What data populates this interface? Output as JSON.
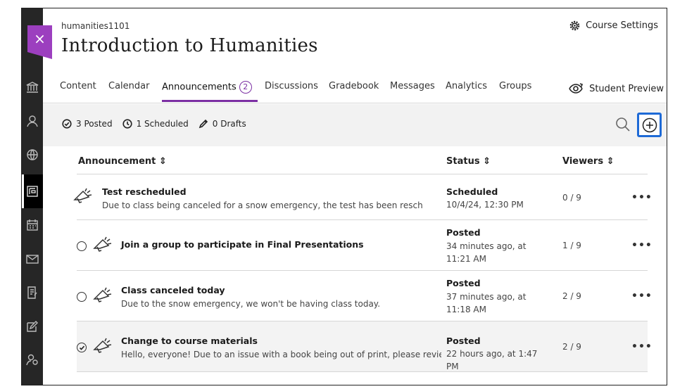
{
  "header": {
    "close_glyph": "×",
    "course_id": "humanities1101",
    "course_title": "Introduction to Humanities",
    "settings_label": "Course Settings"
  },
  "rail_icons": [
    "institution-icon",
    "profile-icon",
    "globe-icon",
    "courses-icon",
    "calendar-icon",
    "messages-icon",
    "grades-icon",
    "tools-icon",
    "groups-icon"
  ],
  "tabs": [
    {
      "label": "Content"
    },
    {
      "label": "Calendar"
    },
    {
      "label": "Announcements",
      "badge": "2"
    },
    {
      "label": "Discussions"
    },
    {
      "label": "Gradebook"
    },
    {
      "label": "Messages"
    },
    {
      "label": "Analytics"
    },
    {
      "label": "Groups"
    }
  ],
  "preview_label": "Student Preview",
  "summary": {
    "posted": "3 Posted",
    "scheduled": "1 Scheduled",
    "drafts": "0 Drafts"
  },
  "table": {
    "headers": {
      "announcement": "Announcement ⇕",
      "status": "Status ⇕",
      "viewers": "Viewers ⇕"
    },
    "rows": [
      {
        "title": "Test rescheduled",
        "desc": "Due to class being canceled for a snow emergency, the test has been resched...",
        "status": "Scheduled",
        "when": "10/4/24, 12:30 PM",
        "viewers": "0 / 9",
        "more": "•••"
      },
      {
        "title": "Join a group to participate in Final Presentations",
        "desc": "",
        "status": "Posted",
        "when": "34 minutes ago, at 11:21 AM",
        "viewers": "1 / 9",
        "more": "•••"
      },
      {
        "title": "Class canceled today",
        "desc": "Due to the snow emergency, we won't be having class today.",
        "status": "Posted",
        "when": "37 minutes ago, at 11:18 AM",
        "viewers": "2 / 9",
        "more": "•••"
      },
      {
        "title": "Change to course materials",
        "desc": "Hello, everyone! Due to an issue with a book being out of print, please review ...",
        "status": "Posted",
        "when": "22 hours ago, at 1:47 PM",
        "viewers": "2 / 9",
        "more": "•••"
      }
    ]
  },
  "colors": {
    "accent": "#7b2fa3",
    "close_flag": "#9c3fbf",
    "focus_ring": "#1e6ad6",
    "rail": "#262626"
  }
}
